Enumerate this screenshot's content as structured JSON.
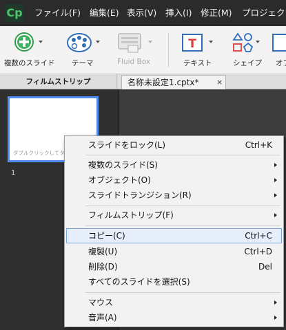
{
  "app": {
    "logo": "Cp"
  },
  "menubar": {
    "items": [
      "ファイル(F)",
      "編集(E)",
      "表示(V)",
      "挿入(I)",
      "修正(M)",
      "プロジェクト"
    ]
  },
  "toolbar": {
    "new_slide": "複数のスライド",
    "theme": "テーマ",
    "fluid_box": "Fluid Box",
    "text": "テキスト",
    "shape": "シェイプ",
    "object": "オブ"
  },
  "tabs": {
    "filmstrip": "フィルムストリップ",
    "document": "名称未設定1.cptx*",
    "close": "×"
  },
  "filmstrip": {
    "thumb_text": "ダブルクリックしてタ",
    "slide_number": "1"
  },
  "context_menu": {
    "items": [
      {
        "label": "スライドをロック(L)",
        "shortcut": "Ctrl+K"
      },
      {
        "label": "複数のスライド(S)",
        "shortcut": ""
      },
      {
        "label": "オブジェクト(O)",
        "shortcut": ""
      },
      {
        "label": "スライドトランジション(R)",
        "shortcut": ""
      },
      {
        "label": "フィルムストリップ(F)",
        "shortcut": ""
      },
      {
        "label": "コピー(C)",
        "shortcut": "Ctrl+C"
      },
      {
        "label": "複製(U)",
        "shortcut": "Ctrl+D"
      },
      {
        "label": "削除(D)",
        "shortcut": "Del"
      },
      {
        "label": "すべてのスライドを選択(S)",
        "shortcut": ""
      },
      {
        "label": "マウス",
        "shortcut": ""
      },
      {
        "label": "音声(A)",
        "shortcut": ""
      }
    ]
  },
  "colors": {
    "accent": "#4e8ef0",
    "logo": "#4fc46b",
    "highlight": "#e6eefb"
  }
}
